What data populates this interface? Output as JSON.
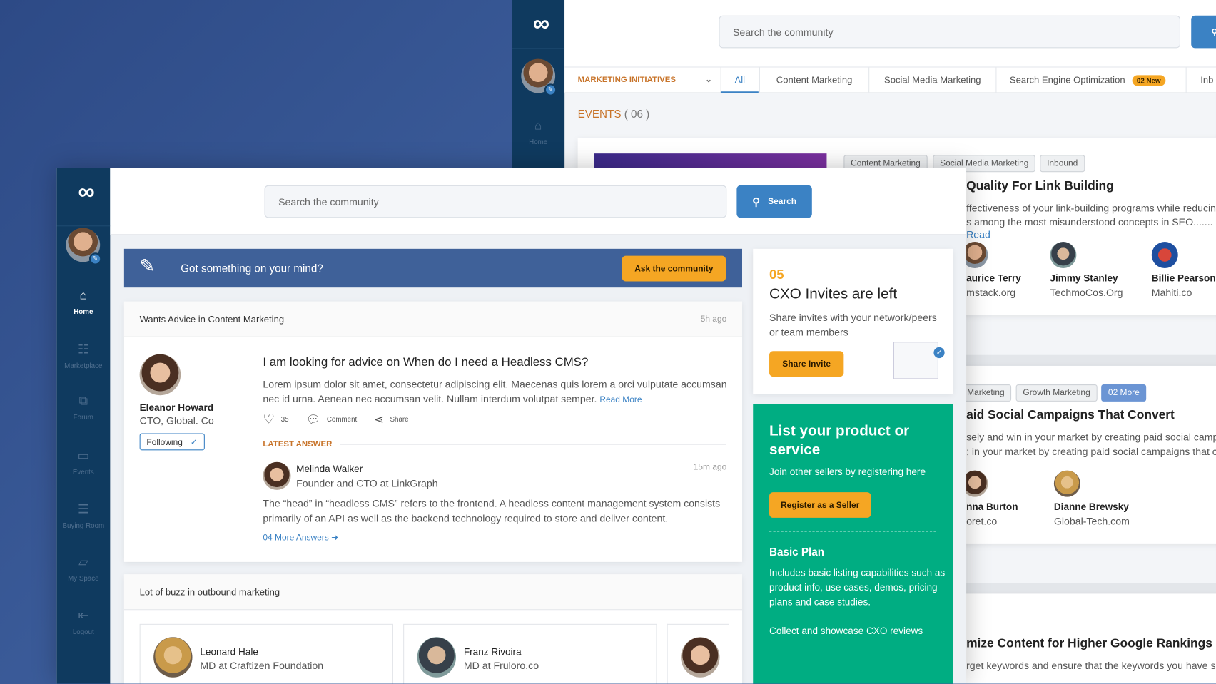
{
  "back": {
    "search_placeholder": "Search the community",
    "nav_home": "Home",
    "filter_label": "MARKETING INITIATIVES",
    "tabs": [
      {
        "label": "All",
        "active": true
      },
      {
        "label": "Content Marketing"
      },
      {
        "label": "Social Media Marketing"
      },
      {
        "label": "Search Engine Optimization",
        "badge": "02 New"
      },
      {
        "label": "Inb"
      }
    ],
    "events_title": "EVENTS",
    "events_count": "( 06 )",
    "event1": {
      "tags": [
        "Content Marketing",
        "Social Media Marketing",
        "Inbound"
      ],
      "title": "Quality For Link Building",
      "line1": "ffectiveness of your link-building programs while reducing",
      "line2": "s among the most misunderstood concepts in SEO.......",
      "read": "Read",
      "people": [
        {
          "name": "aurice Terry",
          "org": "mstack.org"
        },
        {
          "name": "Jimmy Stanley",
          "org": "TechmoCos.Org"
        },
        {
          "name": "Billie Pearson",
          "org": "Mahiti.co"
        }
      ]
    },
    "event2": {
      "tags": [
        "Marketing",
        "Growth Marketing"
      ],
      "more": "02 More",
      "title": "aid Social Campaigns That Convert",
      "line1": "sely and win in your market by creating paid social campa",
      "line2": "; in your market by creating paid social campaigns that co",
      "people": [
        {
          "name": "nna Burton",
          "org": "oret.co"
        },
        {
          "name": "Dianne Brewsky",
          "org": "Global-Tech.com"
        }
      ]
    },
    "event3": {
      "title": "mize Content for Higher Google Rankings",
      "line1": "rget keywords and ensure that the keywords you have se"
    }
  },
  "front": {
    "search_placeholder": "Search the community",
    "search_button": "Search",
    "nav": [
      "Home",
      "Marketplace",
      "Forum",
      "Events",
      "Buying Room",
      "My Space",
      "Logout"
    ],
    "banner": {
      "text": "Got something on your mind?",
      "button": "Ask the community"
    },
    "post": {
      "category": "Wants Advice in Content Marketing",
      "time": "5h ago",
      "author": "Eleanor Howard",
      "role": "CTO, Global. Co",
      "follow": "Following",
      "title": "I am looking for advice on When do I need a Headless CMS?",
      "body": "Lorem ipsum dolor sit amet, consectetur adipiscing elit. Maecenas quis lorem a orci vulputate accumsan nec id urna. Aenean nec accumsan velit. Nullam interdum volutpat semper.",
      "read_more": "Read More",
      "likes": "35",
      "comment": "Comment",
      "share": "Share",
      "latest_label": "LATEST ANSWER",
      "answer": {
        "name": "Melinda Walker",
        "role": "Founder and CTO at LinkGraph",
        "time": "15m ago",
        "text": "The “head” in “headless CMS” refers to the frontend. A headless content management system consists primarily of an API as well as the backend technology required to store and deliver content."
      },
      "more_answers": "04 More Answers"
    },
    "buzz": {
      "title": "Lot of buzz in outbound marketing",
      "people": [
        {
          "name": "Leonard Hale",
          "role": "MD at Craftizen Foundation"
        },
        {
          "name": "Franz Rivoira",
          "role": "MD at Fruloro.co"
        }
      ]
    },
    "invites": {
      "count": "05",
      "title": "CXO Invites are left",
      "text": "Share invites with your network/peers or team members",
      "button": "Share Invite"
    },
    "seller": {
      "title": "List your product or service",
      "sub": "Join other sellers by registering here",
      "button": "Register as a Seller",
      "plan": "Basic Plan",
      "plan_text": "Includes basic listing capabilities such as product info, use cases, demos, pricing plans and case studies.",
      "extra": "Collect and showcase CXO reviews"
    }
  },
  "colors": {
    "sidebar": "#0f3a5f",
    "accent_blue": "#3b82c4",
    "orange": "#f5a623",
    "green": "#00ad82",
    "banner": "#3f6199"
  }
}
